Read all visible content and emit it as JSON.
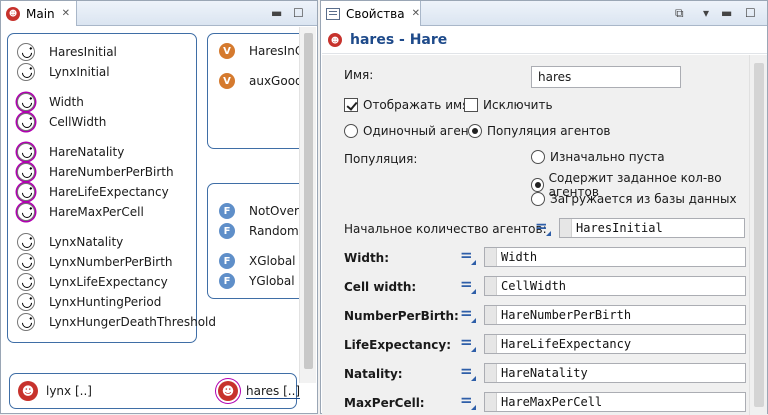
{
  "left_editor": {
    "tab_label": "Main",
    "canvas": {
      "params": [
        {
          "label": "HaresInitial",
          "selected": false
        },
        {
          "label": "LynxInitial",
          "selected": false
        },
        {
          "label": "Width",
          "selected": true
        },
        {
          "label": "CellWidth",
          "selected": true
        },
        {
          "label": "HareNatality",
          "selected": true
        },
        {
          "label": "HareNumberPerBirth",
          "selected": true
        },
        {
          "label": "HareLifeExpectancy",
          "selected": true
        },
        {
          "label": "HareMaxPerCell",
          "selected": true
        },
        {
          "label": "LynxNatality",
          "selected": false
        },
        {
          "label": "LynxNumberPerBirth",
          "selected": false
        },
        {
          "label": "LynxLifeExpectancy",
          "selected": false
        },
        {
          "label": "LynxHuntingPeriod",
          "selected": false
        },
        {
          "label": "LynxHungerDeathThreshold",
          "selected": false
        }
      ],
      "variables": [
        {
          "label": "HaresInC",
          "badge": "V"
        },
        {
          "label": "auxGood",
          "badge": "V"
        }
      ],
      "functions": [
        {
          "label": "NotOverp",
          "badge": "F"
        },
        {
          "label": "RandomC",
          "badge": "F"
        },
        {
          "label": "XGlobal",
          "badge": "F"
        },
        {
          "label": "YGlobal",
          "badge": "F"
        }
      ],
      "agents": [
        {
          "label": "lynx [..]"
        },
        {
          "label": "hares [..]"
        }
      ]
    }
  },
  "properties": {
    "tab_label": "Свойства",
    "title": "hares - Hare",
    "name_label": "Имя:",
    "name_value": "hares",
    "show_name_label": "Отображать имя",
    "show_name_checked": true,
    "exclude_label": "Исключить",
    "exclude_checked": false,
    "single_agent_label": "Одиночный агент",
    "population_label": "Популяция агентов",
    "population_section_label": "Популяция:",
    "pop_options": [
      {
        "label": "Изначально пуста",
        "selected": false
      },
      {
        "label": "Содержит заданное кол-во агентов",
        "selected": true
      },
      {
        "label": "Загружается из базы данных",
        "selected": false
      }
    ],
    "initial_count_label": "Начальное количество агентов:",
    "initial_count_value": "HaresInitial",
    "fields": [
      {
        "label": "Width:",
        "value": "Width"
      },
      {
        "label": "Cell width:",
        "value": "CellWidth"
      },
      {
        "label": "NumberPerBirth:",
        "value": "HareNumberPerBirth"
      },
      {
        "label": "LifeExpectancy:",
        "value": "HareLifeExpectancy"
      },
      {
        "label": "Natality:",
        "value": "HareNatality"
      },
      {
        "label": "MaxPerCell:",
        "value": "HareMaxPerCell"
      }
    ]
  },
  "colors": {
    "accent": "#1e4a8a",
    "selection": "#b000b0",
    "agent": "#c7322c",
    "variable_badge": "#d57a2e",
    "function_badge": "#5f8fc9"
  }
}
